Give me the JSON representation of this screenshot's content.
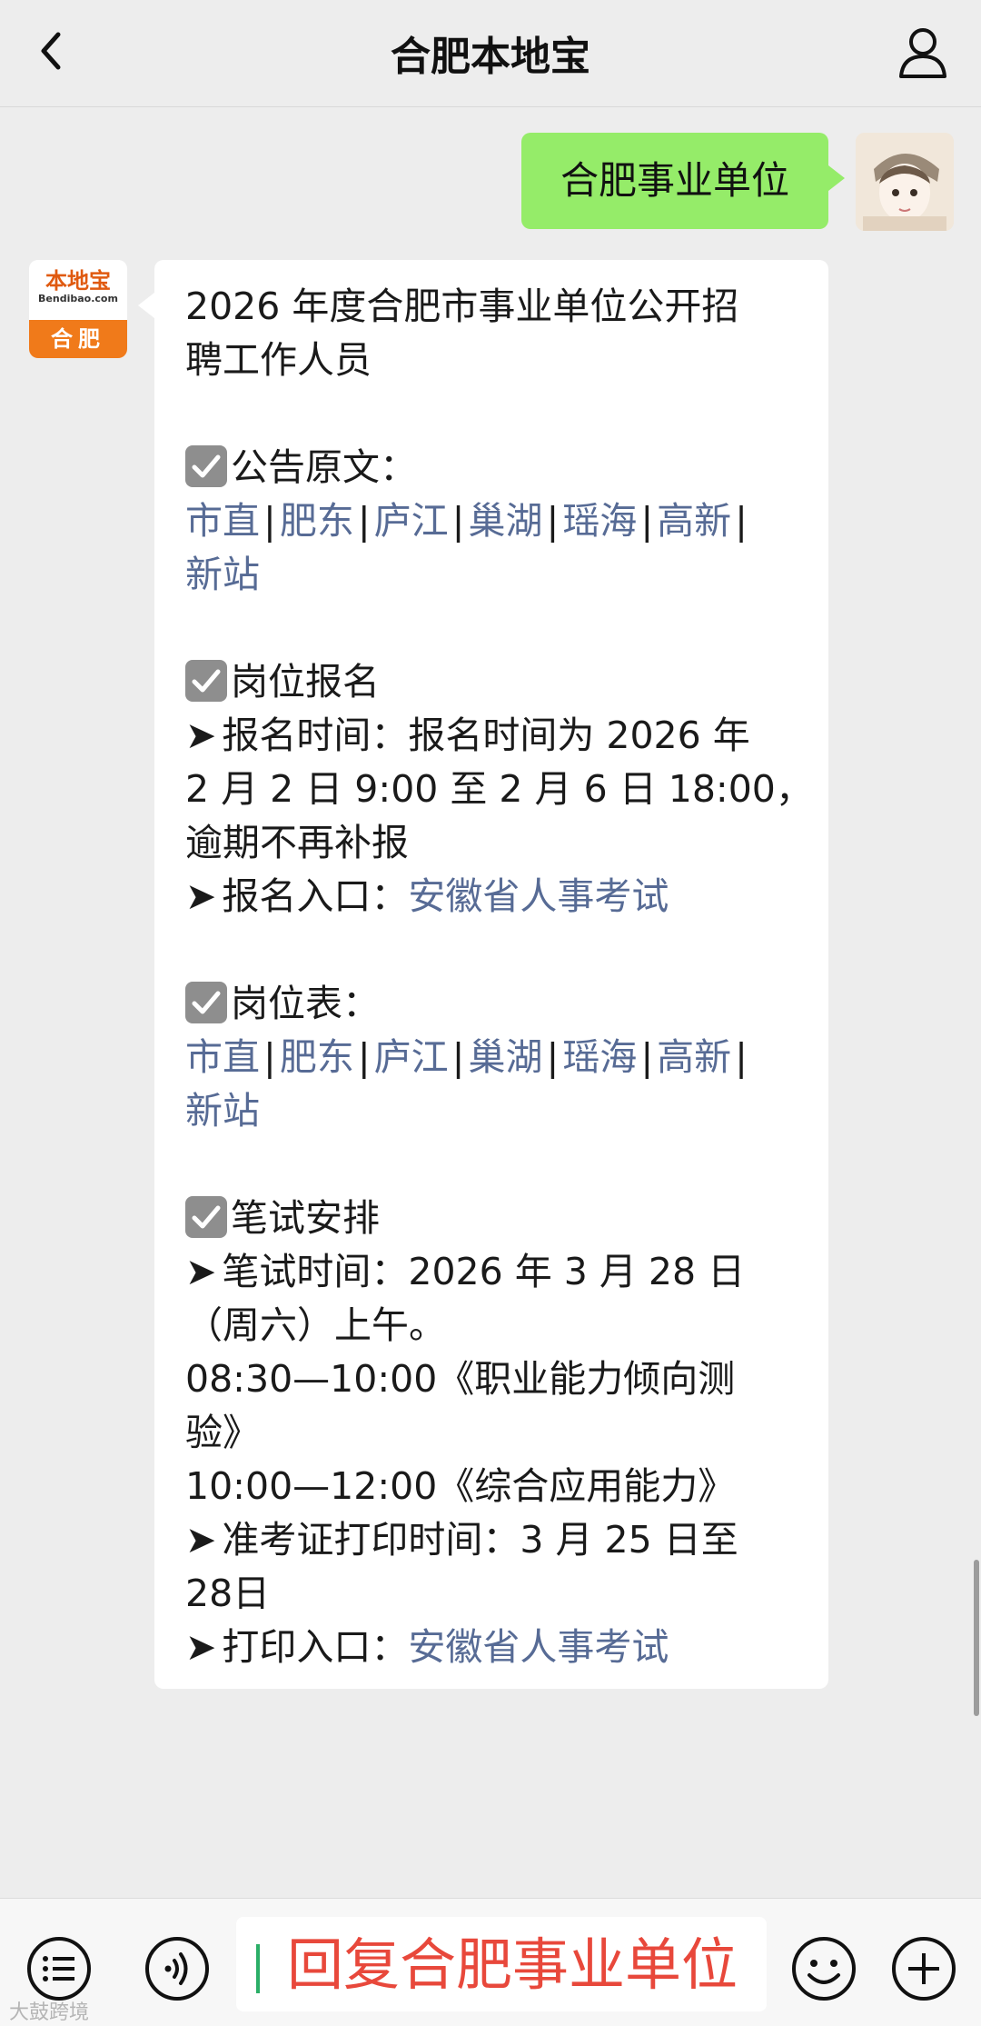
{
  "header": {
    "title": "合肥本地宝",
    "back_icon": "chevron-left-icon",
    "profile_icon": "person-icon"
  },
  "messages": {
    "user_text": "合肥事业单位",
    "bot_avatar": {
      "brand": "本地宝",
      "domain": "Bendibao.com",
      "city": "合肥"
    }
  },
  "article": {
    "title_line1": "2026 年度合肥市事业单位公开招",
    "title_line2": "聘工作人员",
    "sec1_title": "公告原文：",
    "sec1_links": [
      "市直",
      "肥东",
      "庐江",
      "巢湖",
      "瑶海",
      "高新"
    ],
    "sec1_link_last": "新站",
    "separator": "|",
    "sec2_title": "岗位报名",
    "sec2_l1": "报名时间：报名时间为 2026 年",
    "sec2_l2": "2 月 2 日 9:00 至 2 月 6 日 18:00，",
    "sec2_l3": "逾期不再补报",
    "sec2_l4_prefix": "报名入口：",
    "sec2_l4_link": "安徽省人事考试",
    "sec3_title": "岗位表：",
    "sec3_links": [
      "市直",
      "肥东",
      "庐江",
      "巢湖",
      "瑶海",
      "高新"
    ],
    "sec3_link_last": "新站",
    "sec4_title": "笔试安排",
    "sec4_l1": "笔试时间：2026 年 3 月 28 日",
    "sec4_l2": "（周六）上午。",
    "sec4_l3": "08:30—10:00《职业能力倾向测",
    "sec4_l4": "验》",
    "sec4_l5": "10:00—12:00《综合应用能力》",
    "sec4_l6": "准考证打印时间：3 月 25 日至",
    "sec4_l7": "28日",
    "sec4_l8_prefix": "打印入口：",
    "sec4_l8_link": "安徽省人事考试",
    "arrow": "➤"
  },
  "input": {
    "text": "回复合肥事业单位"
  },
  "toolbar": {
    "menu_icon": "list-menu-icon",
    "voice_icon": "voice-icon",
    "emoji_icon": "emoji-icon",
    "plus_icon": "plus-icon"
  },
  "watermark": "大鼓跨境",
  "colors": {
    "my_bubble": "#95ec69",
    "link": "#576b95",
    "input_text": "#e8483b",
    "background": "#ededed"
  }
}
